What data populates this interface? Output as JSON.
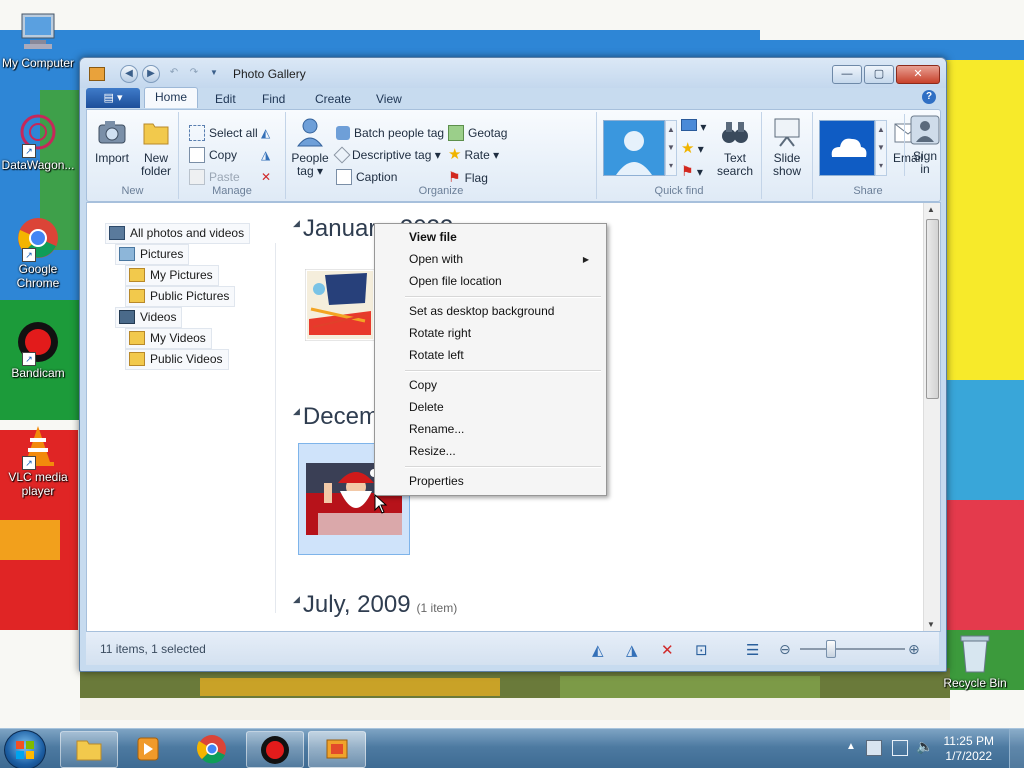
{
  "desktop": {
    "icons": [
      {
        "label": "My Computer"
      },
      {
        "label": "DataWagon..."
      },
      {
        "label": "Google Chrome"
      },
      {
        "label": "Bandicam"
      },
      {
        "label": "VLC media player"
      },
      {
        "label": "Recycle Bin"
      }
    ]
  },
  "window": {
    "title": "Photo Gallery",
    "tabs": [
      "Home",
      "Edit",
      "Find",
      "Create",
      "View"
    ],
    "active_tab": "Home"
  },
  "ribbon": {
    "new": {
      "label": "New",
      "import": "Import",
      "new_folder_1": "New",
      "new_folder_2": "folder"
    },
    "manage": {
      "label": "Manage",
      "select_all": "Select all",
      "copy": "Copy",
      "paste": "Paste"
    },
    "organize": {
      "label": "Organize",
      "people_tag_1": "People",
      "people_tag_2": "tag",
      "batch_people_tag": "Batch people tag",
      "descriptive_tag": "Descriptive tag",
      "caption": "Caption",
      "geotag": "Geotag",
      "rate": "Rate",
      "flag": "Flag"
    },
    "quick_find": {
      "label": "Quick find",
      "text_search_1": "Text",
      "text_search_2": "search"
    },
    "slide_show_1": "Slide",
    "slide_show_2": "show",
    "share": {
      "label": "Share",
      "email": "Email",
      "sign_in_1": "Sign",
      "sign_in_2": "in"
    }
  },
  "nav": {
    "items": [
      "All photos and videos",
      "Pictures",
      "My Pictures",
      "Public Pictures",
      "Videos",
      "My Videos",
      "Public Videos"
    ]
  },
  "groups": [
    {
      "heading": "January, 2022",
      "heading_visible": "Januar",
      "heading_tail": "2022"
    },
    {
      "heading": "December",
      "heading_visible": "Decem"
    },
    {
      "heading": "July, 2009",
      "count": "(1 item)"
    }
  ],
  "context_menu": {
    "items": [
      "View file",
      "Open with",
      "Open file location",
      "Set as desktop background",
      "Rotate right",
      "Rotate left",
      "Copy",
      "Delete",
      "Rename...",
      "Resize...",
      "Properties"
    ]
  },
  "status": {
    "text": "11 items, 1 selected",
    "zoom_level": 0.27
  },
  "taskbar": {
    "time": "11:25 PM",
    "date": "1/7/2022"
  },
  "colors": {
    "accent": "#1d4f9a",
    "selection": "#cfe3fa"
  }
}
